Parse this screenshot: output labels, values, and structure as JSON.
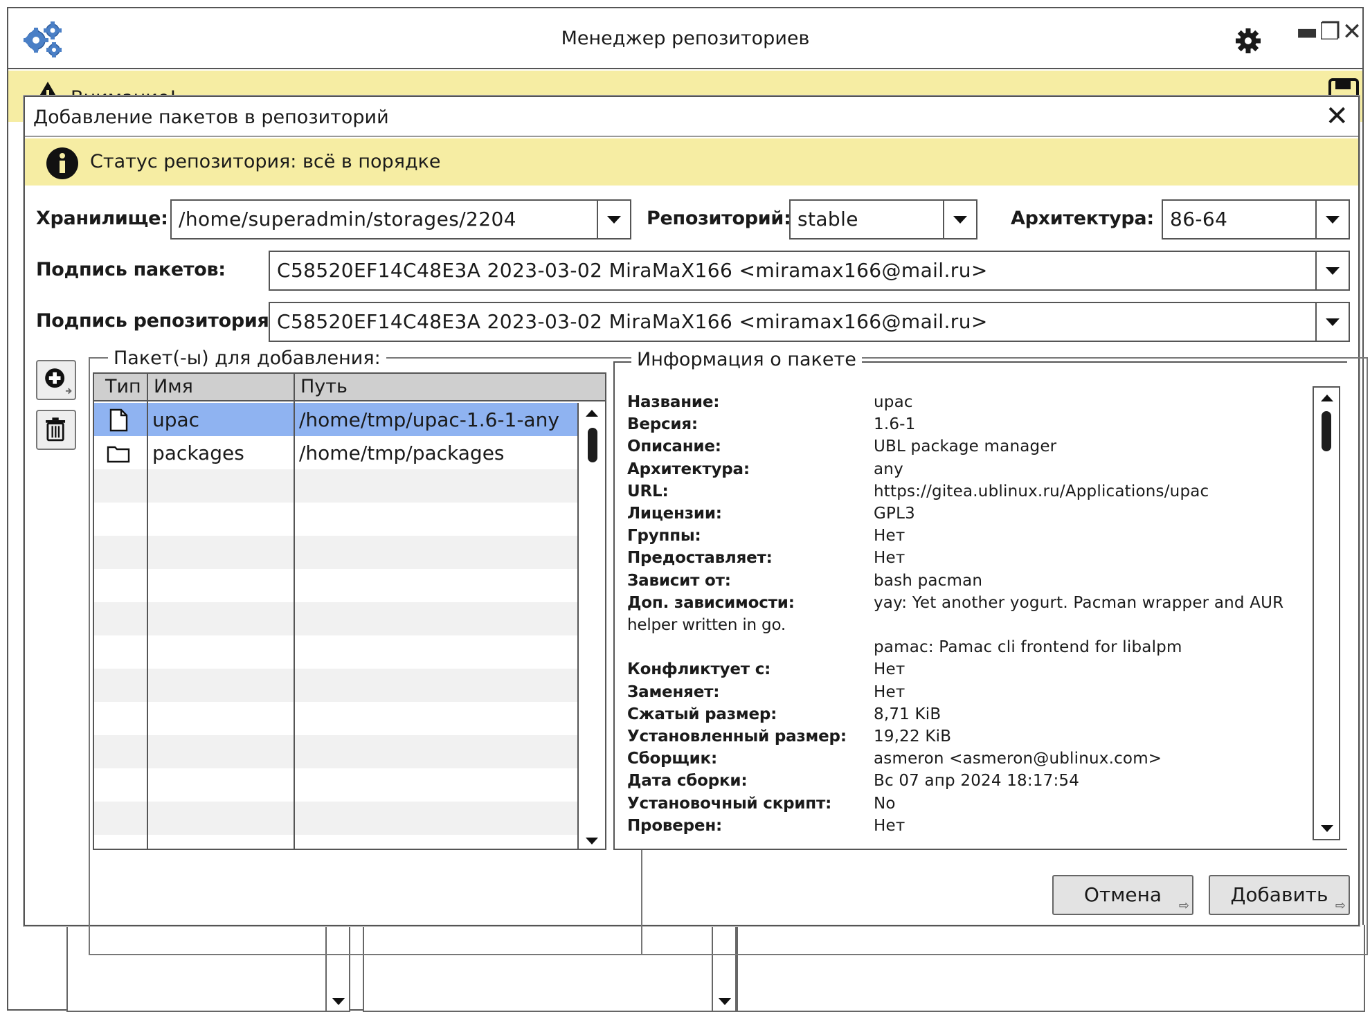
{
  "window": {
    "title": "Менеджер репозиториев",
    "minimize": "▬",
    "maximize": "❐",
    "close": "✕",
    "warning_label": "Внимание!"
  },
  "dialog": {
    "title": "Добавление пакетов в репозиторий",
    "close": "✕",
    "status": "Статус репозитория: всё в порядке",
    "storage_label": "Хранилище:",
    "storage_value": "/home/superadmin/storages/2204",
    "repo_label": "Репозиторий:",
    "repo_value": "stable",
    "arch_label": "Архитектура:",
    "arch_value": "86-64",
    "pkg_sign_label": "Подпись пакетов:",
    "pkg_sign_value": "C58520EF14C48E3A 2023-03-02 MiraMaX166 <miramax166@mail.ru>",
    "repo_sign_label": "Подпись репозитория:",
    "repo_sign_value": "C58520EF14C48E3A 2023-03-02 MiraMaX166 <miramax166@mail.ru>",
    "packages_group": "Пакет(-ы) для добавления:",
    "info_group": "Информация о пакете",
    "cancel": "Отмена",
    "add": "Добавить"
  },
  "table": {
    "columns": [
      "Тип",
      "Имя",
      "Путь"
    ],
    "rows": [
      {
        "type_icon": "file-icon",
        "name": "upac",
        "path": "/home/tmp/upac-1.6-1-any",
        "selected": true
      },
      {
        "type_icon": "folder-icon",
        "name": "packages",
        "path": "/home/tmp/packages",
        "selected": false
      }
    ]
  },
  "info": [
    {
      "k": "Название:",
      "v": "upac"
    },
    {
      "k": "Версия:",
      "v": "1.6-1"
    },
    {
      "k": "Описание:",
      "v": "UBL package manager"
    },
    {
      "k": "Архитектура:",
      "v": "any"
    },
    {
      "k": "URL:",
      "v": "https://gitea.ublinux.ru/Applications/upac"
    },
    {
      "k": "Лицензии:",
      "v": "GPL3"
    },
    {
      "k": "Группы:",
      "v": "Нет"
    },
    {
      "k": "Предоставляет:",
      "v": "Нет"
    },
    {
      "k": "Зависит от:",
      "v": "bash  pacman"
    },
    {
      "k": "Доп. зависимости:",
      "v": "yay: Yet another yogurt. Pacman wrapper and AUR"
    },
    {
      "k": "helper written in go.",
      "v": ""
    },
    {
      "k": "",
      "v": "pamac: Pamac cli frontend for libalpm"
    },
    {
      "k": "Конфликтует с:",
      "v": "Нет"
    },
    {
      "k": "Заменяет:",
      "v": "Нет"
    },
    {
      "k": "Сжатый размер:",
      "v": "8,71 KiB"
    },
    {
      "k": "Установленный размер:",
      "v": "19,22 KiB"
    },
    {
      "k": "Сборщик:",
      "v": "asmeron <asmeron@ublinux.com>"
    },
    {
      "k": "Дата сборки:",
      "v": "Вс 07 апр 2024 18:17:54"
    },
    {
      "k": "Установочный скрипт:",
      "v": "No"
    },
    {
      "k": "Проверен:",
      "v": "Нет"
    }
  ]
}
